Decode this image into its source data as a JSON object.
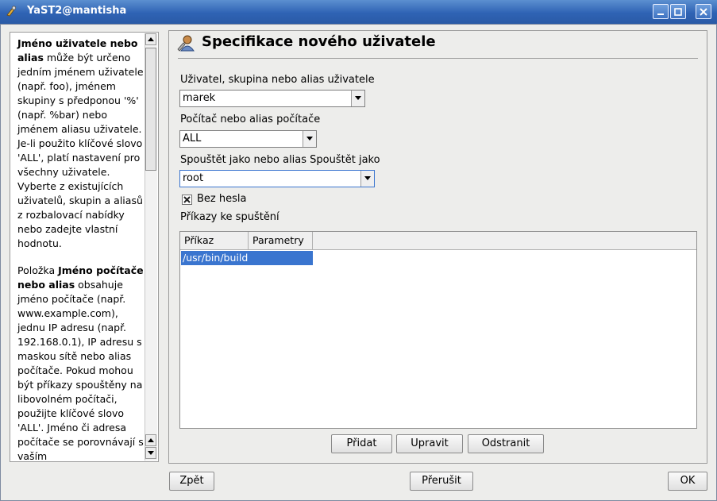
{
  "window": {
    "title": "YaST2@mantisha"
  },
  "help": {
    "p1_bold1": "Jméno uživatele nebo alias",
    "p1_rest": " může být určeno jedním jménem uživatele (např. foo), jménem skupiny s předponou '%' (např. %bar) nebo jménem aliasu uživatele. Je-li použito klíčové slovo 'ALL', platí nastavení pro všechny uživatele. Vyberte z existujících uživatelů, skupin a aliasů z rozbalovací nabídky nebo zadejte vlastní hodnotu.",
    "p2_start": "Položka ",
    "p2_bold": "Jméno počítače nebo alias",
    "p2_rest": " obsahuje jméno počítače (např. www.example.com), jednu IP adresu (např. 192.168.0.1), IP adresu s maskou sítě nebo alias počítače. Pokud mohou být příkazy spouštěny na libovolném počítači, použijte klíčové slovo 'ALL'. Jméno či adresa počítače se porovnávají s vaším"
  },
  "main": {
    "heading": "Specifikace nového uživatele",
    "user_label": "Uživatel, skupina nebo alias uživatele",
    "user_value": "marek",
    "host_label": "Počítač nebo alias počítače",
    "host_value": "ALL",
    "runas_label": "Spouštět jako nebo alias Spouštět jako",
    "runas_value": "root",
    "nopasswd_label": "Bez hesla",
    "nopasswd_checked": true,
    "commands_label": "Příkazy ke spuštění",
    "table": {
      "columns": [
        "Příkaz",
        "Parametry"
      ],
      "rows": [
        [
          "/usr/bin/build",
          ""
        ]
      ]
    },
    "add_label": "Přidat",
    "edit_label": "Upravit",
    "delete_label": "Odstranit"
  },
  "footer": {
    "back_label": "Zpět",
    "abort_label": "Přerušit",
    "ok_label": "OK"
  },
  "colors": {
    "titlebar": "#2f63b4",
    "selection": "#3a75cf"
  }
}
